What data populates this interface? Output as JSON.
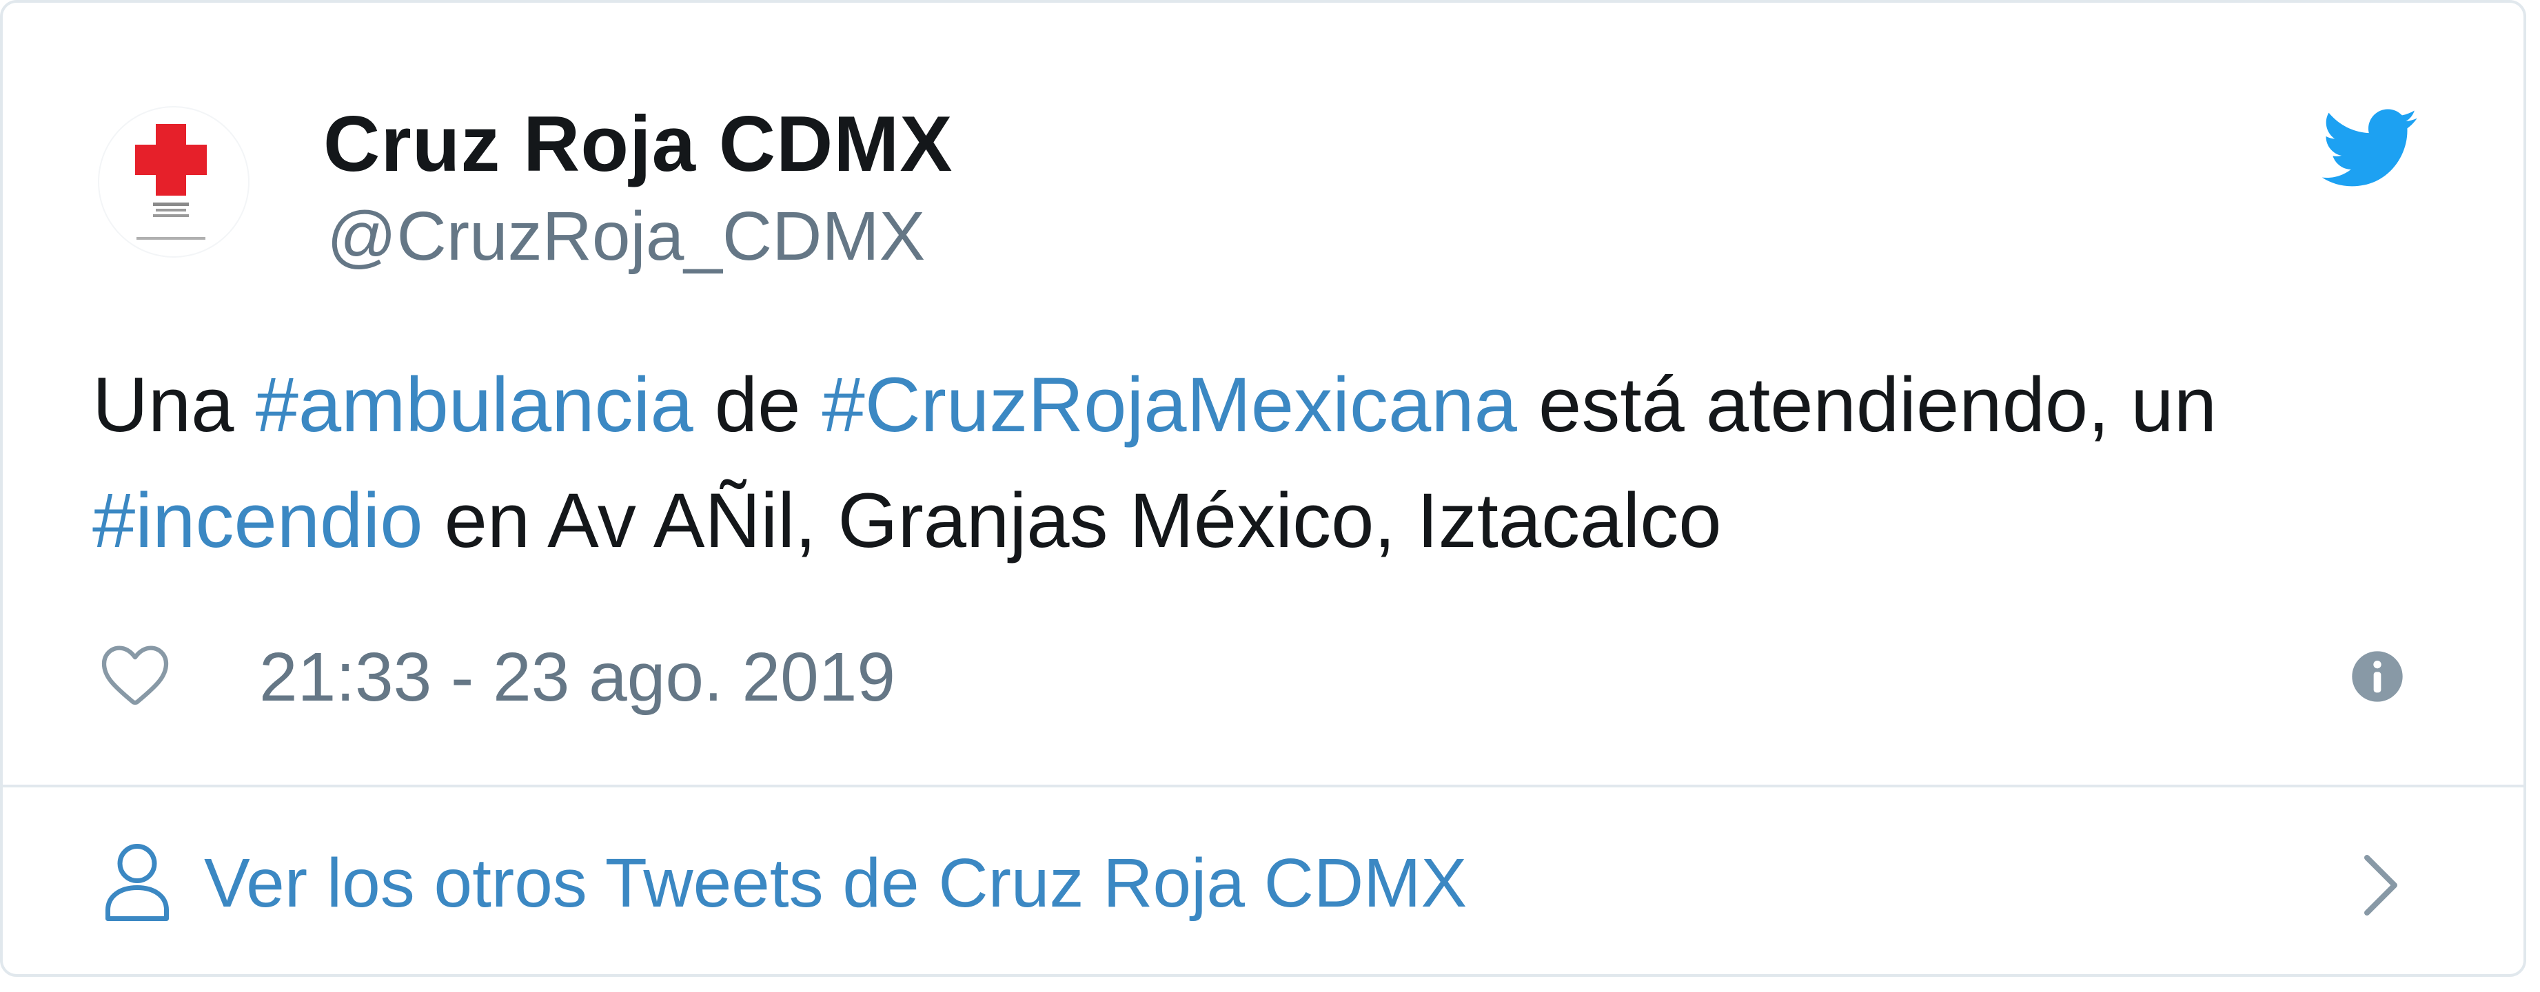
{
  "tweet": {
    "author": {
      "display_name": "Cruz Roja CDMX",
      "handle": "@CruzRoja_CDMX",
      "avatar_icon": "red-cross-logo-icon"
    },
    "body": {
      "t1": "Una ",
      "h1": "#ambulancia",
      "t2": " de ",
      "h2": "#CruzRojaMexicana",
      "t3": " está atendiendo, un ",
      "h3": "#incendio",
      "t4": " en Av AÑil, Granjas México, Iztacalco"
    },
    "timestamp": "21:33 - 23 ago. 2019",
    "like_icon": "heart-icon",
    "info_icon": "info-icon",
    "brand_icon": "twitter-bird-icon"
  },
  "footer": {
    "link_label": "Ver los otros Tweets de Cruz Roja CDMX",
    "icon": "person-icon",
    "chevron_icon": "chevron-right-icon"
  },
  "colors": {
    "link_blue": "#3b88c3",
    "twitter_blue": "#1da1f2",
    "text": "#14171a",
    "muted": "#657786",
    "border": "#e1e8ed",
    "cross_red": "#e6202a"
  }
}
